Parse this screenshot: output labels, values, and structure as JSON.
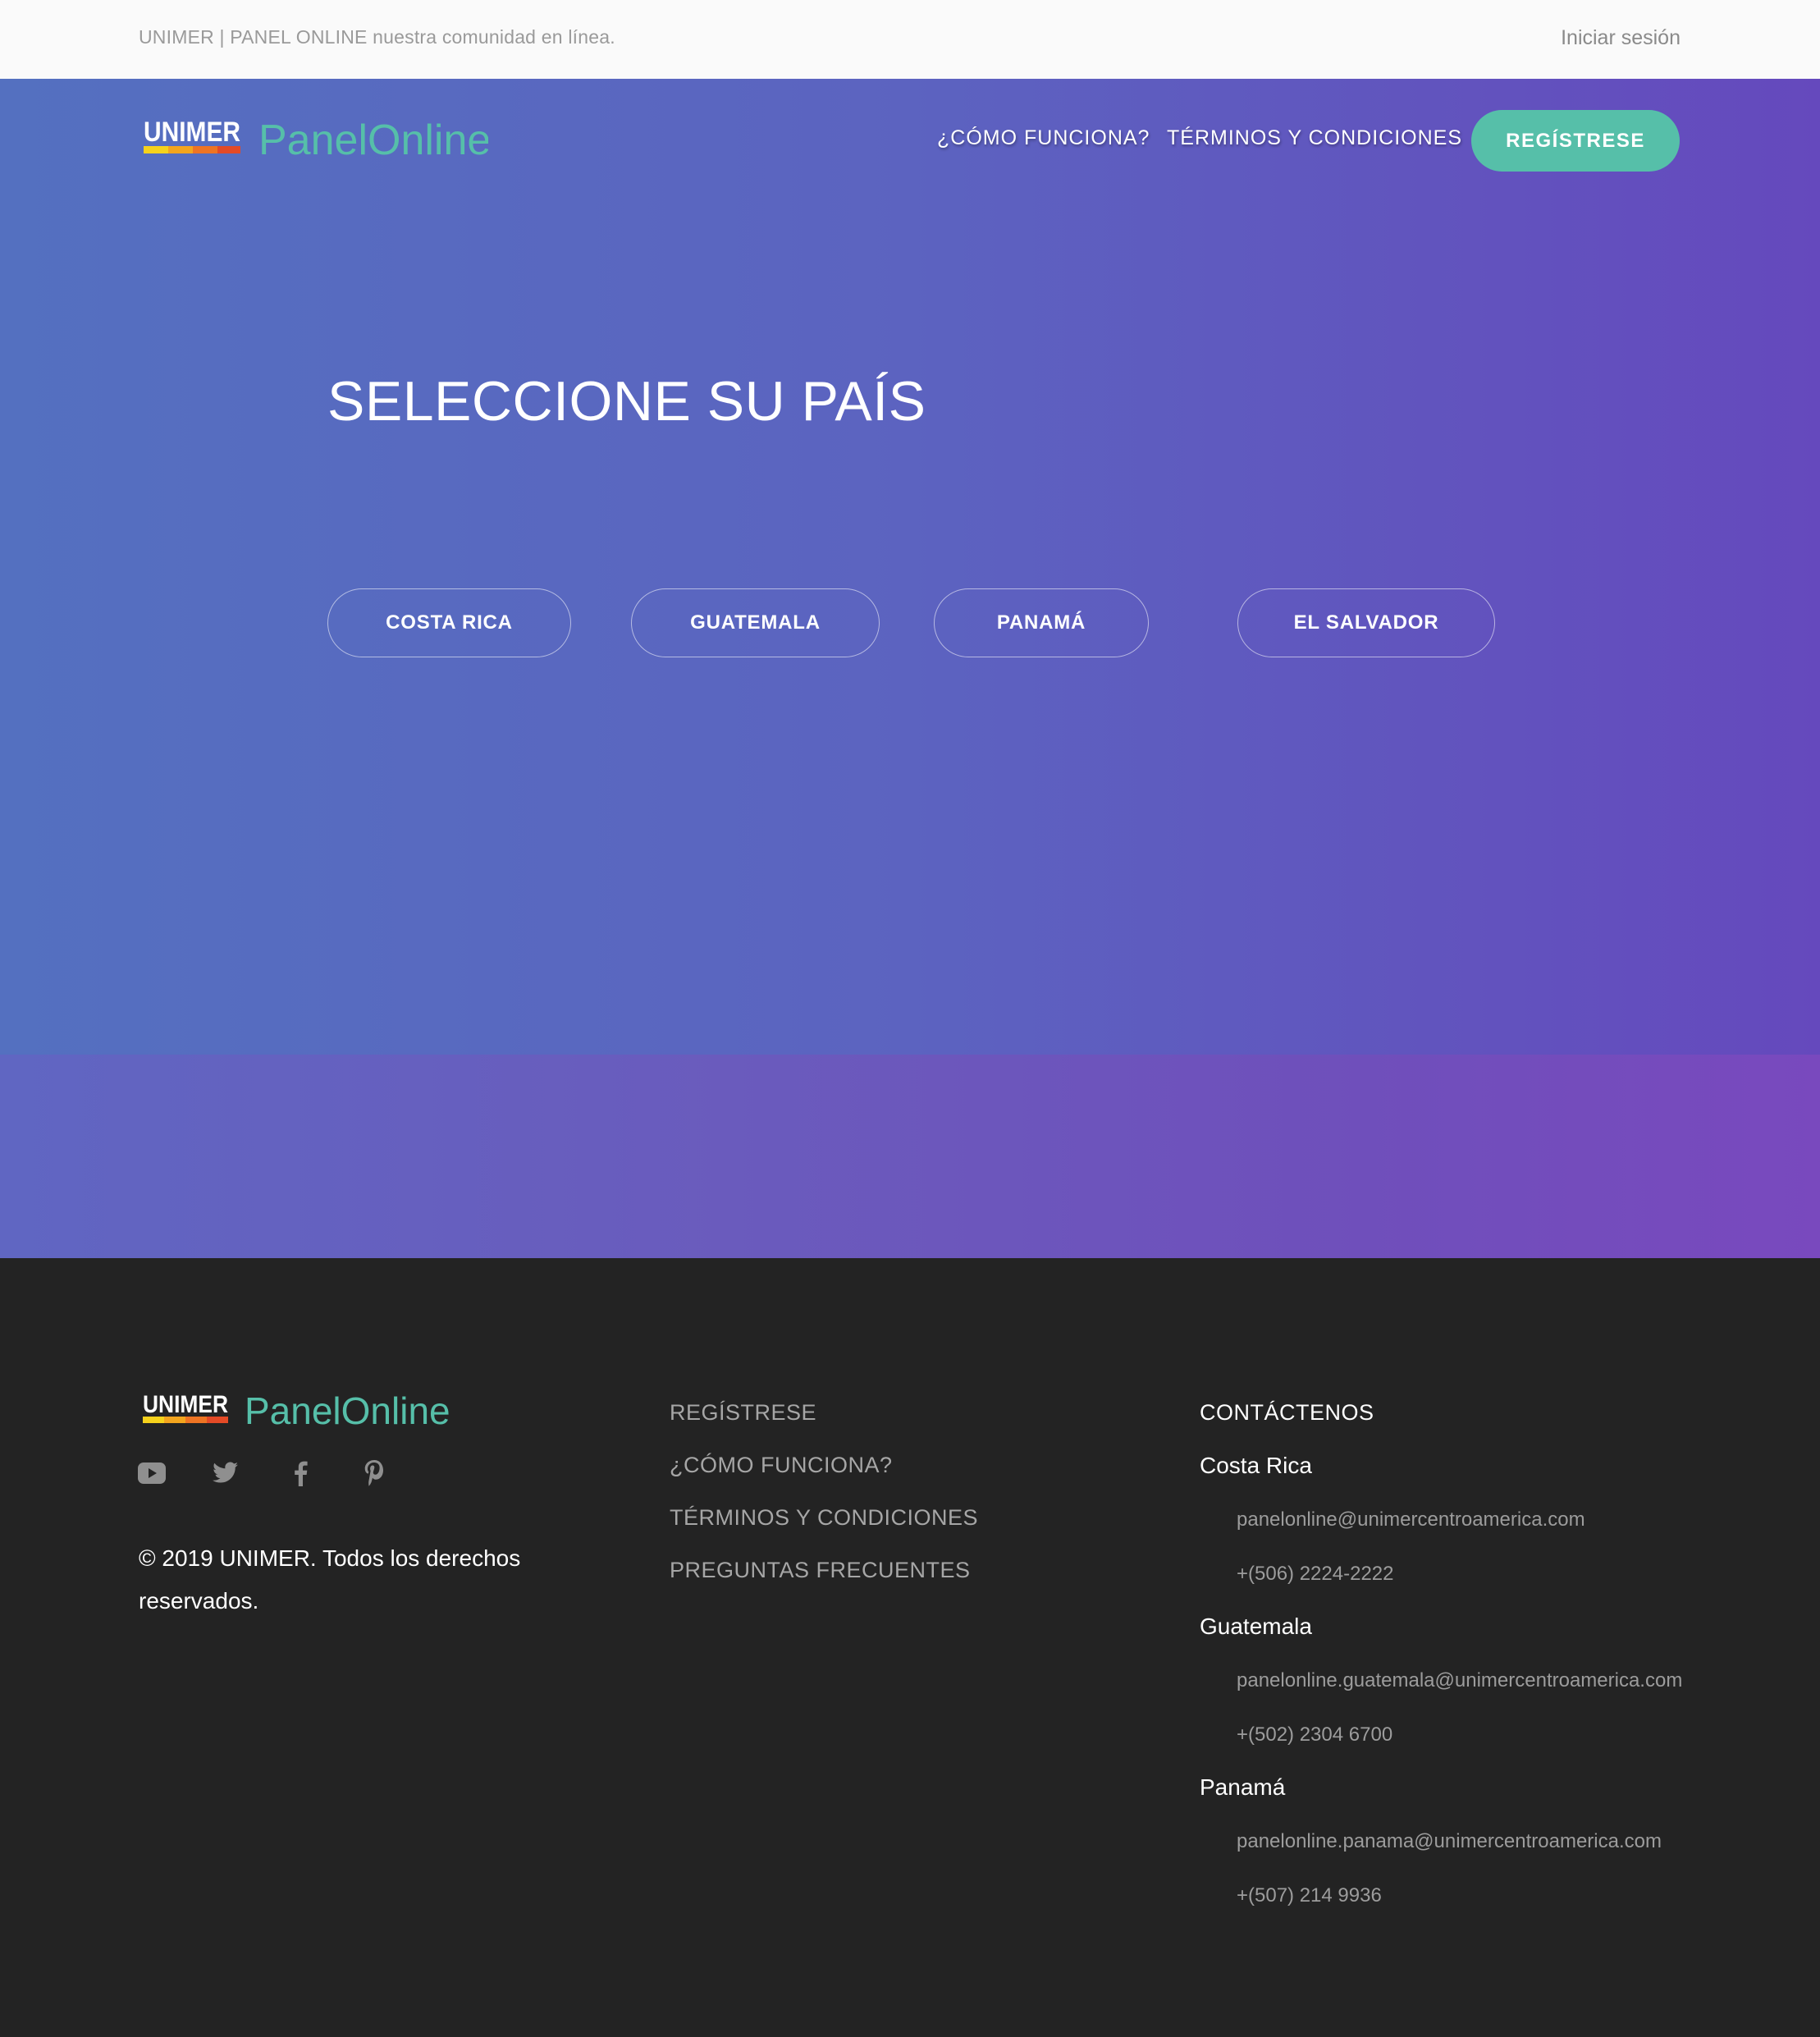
{
  "topbar": {
    "tagline": "UNIMER | PANEL ONLINE nuestra comunidad en línea.",
    "login": "Iniciar sesión"
  },
  "brand": {
    "unimer": "UNIMER",
    "panel": "Panel",
    "online": "Online",
    "accent_color": "#56bfa9"
  },
  "nav": {
    "how": "¿CÓMO FUNCIONA?",
    "terms": "TÉRMINOS Y CONDICIONES",
    "register": "REGÍSTRESE"
  },
  "hero": {
    "title": "SELECCIONE SU PAÍS",
    "countries": [
      "COSTA RICA",
      "GUATEMALA",
      "PANAMÁ",
      "EL SALVADOR"
    ]
  },
  "footer": {
    "social": [
      "youtube-icon",
      "twitter-icon",
      "facebook-icon",
      "pinterest-icon"
    ],
    "copyright": "© 2019 UNIMER. Todos los derechos reservados.",
    "links": [
      "REGÍSTRESE",
      "¿CÓMO FUNCIONA?",
      "TÉRMINOS Y CONDICIONES",
      "PREGUNTAS FRECUENTES"
    ],
    "contact_title": "CONTÁCTENOS",
    "contacts": [
      {
        "country": "Costa Rica",
        "email": "panelonline@unimercentroamerica.com",
        "phone": "+(506) 2224-2222"
      },
      {
        "country": "Guatemala",
        "email": "panelonline.guatemala@unimercentroamerica.com",
        "phone": "+(502) 2304 6700"
      },
      {
        "country": "Panamá",
        "email": "panelonline.panama@unimercentroamerica.com",
        "phone": "+(507) 214 9936"
      }
    ]
  }
}
